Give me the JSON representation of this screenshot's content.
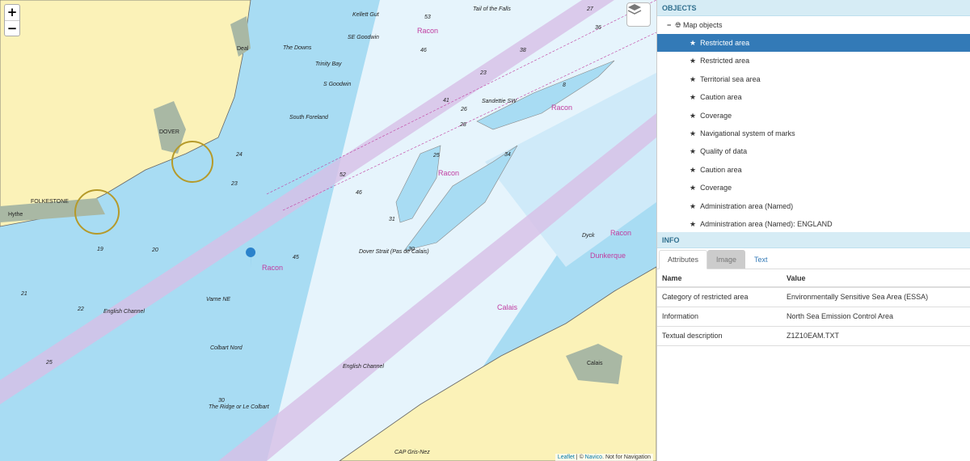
{
  "map": {
    "zoom_in": "+",
    "zoom_out": "−",
    "attribution": {
      "leaflet": "Leaflet",
      "separator": " | © ",
      "navico": "Navico",
      "note": ". Not for Navigation"
    },
    "labels": {
      "dover_strait": "Dover Strait (Pas de Calais)",
      "english_channel_1": "English Channel",
      "english_channel_2": "English Channel",
      "folkestone": "FOLKESTONE",
      "dover": "DOVER",
      "deal": "Deal",
      "hythe": "Hythe",
      "calais_town": "Calais",
      "calais": "Calais",
      "dunkerque": "Dunkerque",
      "racon_1": "Racon",
      "racon_2": "Racon",
      "racon_3": "Racon",
      "racon_4": "Racon",
      "racon_5": "Racon",
      "the_downs": "The Downs",
      "trinity_bay": "Trinity Bay",
      "south_foreland": "South Foreland",
      "kellett_gut": "Kellett Gut",
      "tail_of_the_falls": "Tail of the Falls",
      "ridge": "The Ridge or Le Colbart",
      "colbart_nord": "Colbart Nord",
      "varne_ne": "Varne NE",
      "dyck": "Dyck",
      "sandettie": "Sandettie SW",
      "se_goodwin": "SE Goodwin",
      "s_goodwin": "S Goodwin",
      "gris_nez": "CAP Gris-Nez"
    },
    "depths": [
      "53",
      "46",
      "41",
      "38",
      "36",
      "27",
      "25",
      "23",
      "26",
      "28",
      "34",
      "30",
      "45",
      "46",
      "52",
      "31",
      "24",
      "23",
      "19",
      "20",
      "21",
      "22",
      "25",
      "30",
      "8"
    ],
    "colors": {
      "land": "#fbf2b8",
      "shallow": "#a8dcf3",
      "deep": "#e6f4fc",
      "lane": "#c7b3e0",
      "magenta": "#c03ca0"
    }
  },
  "objects": {
    "title": "OBJECTS",
    "root": "Map objects",
    "items": [
      "Restricted area",
      "Restricted area",
      "Territorial sea area",
      "Caution area",
      "Coverage",
      "Navigational system of marks",
      "Quality of data",
      "Caution area",
      "Coverage",
      "Administration area (Named)",
      "Administration area (Named): ENGLAND"
    ],
    "selected_index": 0
  },
  "info": {
    "title": "INFO",
    "tabs": [
      "Attributes",
      "Image",
      "Text"
    ],
    "active_tab": "Attributes",
    "columns": [
      "Name",
      "Value"
    ],
    "rows": [
      {
        "name": "Category of restricted area",
        "value": "Environmentally Sensitive Sea Area (ESSA)"
      },
      {
        "name": "Information",
        "value": "North Sea Emission Control Area"
      },
      {
        "name": "Textual description",
        "value": "Z1Z10EAM.TXT"
      }
    ]
  }
}
